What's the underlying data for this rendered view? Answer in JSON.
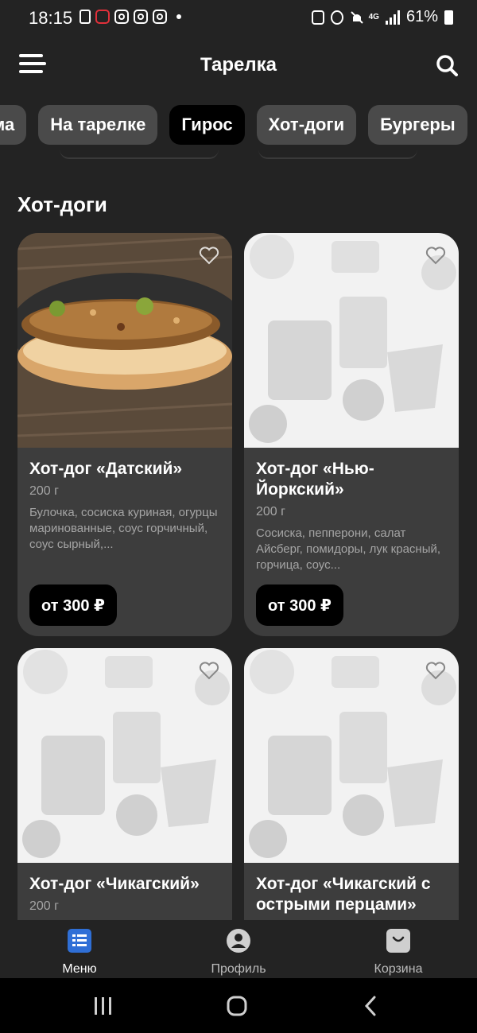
{
  "status": {
    "time": "18:15",
    "network": "4G",
    "battery": "61%"
  },
  "appbar": {
    "title": "Тарелка",
    "menu_icon": "hamburger-menu-icon",
    "search_icon": "search-icon"
  },
  "categories": [
    "ма",
    "На тарелке",
    "Гирос",
    "Хот-доги",
    "Бургеры"
  ],
  "active_category": "Гирос",
  "section": {
    "title": "Хот-доги"
  },
  "products": [
    {
      "name": "Хот-дог «Датский»",
      "weight": "200 г",
      "description": "Булочка, сосиска куриная, огурцы маринованные, соус горчичный, соус сырный,...",
      "price": "от 300 ₽",
      "image": "photo"
    },
    {
      "name": "Хот-дог «Нью-Йоркский»",
      "weight": "200 г",
      "description": "Сосиска, пепперони, салат Айсберг, помидоры, лук красный, горчица, соус...",
      "price": "от 300 ₽",
      "image": "placeholder"
    },
    {
      "name": "Хот-дог «Чикагский»",
      "weight": "200 г",
      "image": "placeholder"
    },
    {
      "name": "Хот-дог «Чикагский с острыми перцами»",
      "image": "placeholder"
    }
  ],
  "bottom_nav": [
    {
      "label": "Меню",
      "icon": "menu-list-icon",
      "active": true
    },
    {
      "label": "Профиль",
      "icon": "profile-icon",
      "active": false
    },
    {
      "label": "Корзина",
      "icon": "cart-bag-icon",
      "active": false
    }
  ],
  "colors": {
    "background": "#232323",
    "card": "#3d3d3d",
    "chip": "#4a4a4a",
    "accent": "#2f6fd6"
  }
}
